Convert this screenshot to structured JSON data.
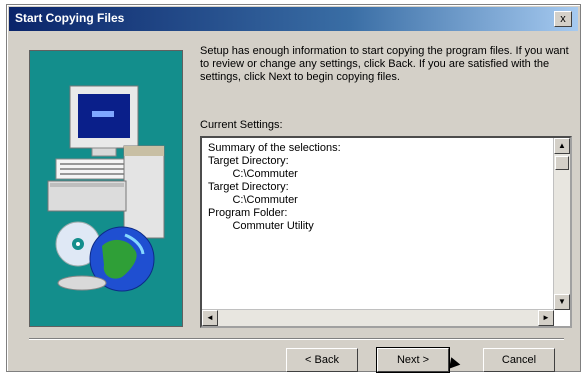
{
  "window": {
    "title": "Start Copying Files",
    "close_glyph": "x"
  },
  "intro_text": "Setup has enough information to start copying the program files. If you want to review or change any settings, click Back. If you are satisfied with the settings, click Next to begin copying files.",
  "current_settings_label": "Current Settings:",
  "settings_lines": [
    "Summary of the selections:",
    "",
    "",
    "Target Directory:",
    "        C:\\Commuter",
    "",
    "Target Directory:",
    "        C:\\Commuter",
    "",
    "Program Folder:",
    "        Commuter Utility"
  ],
  "buttons": {
    "back": "< Back",
    "next": "Next >",
    "cancel": "Cancel"
  },
  "scroll": {
    "up": "▲",
    "down": "▼",
    "left": "◄",
    "right": "►"
  },
  "icons": {
    "art": "computer-and-globe-illustration"
  },
  "colors": {
    "titlebar": "#0a246a",
    "art_bg": "#138e8c"
  }
}
